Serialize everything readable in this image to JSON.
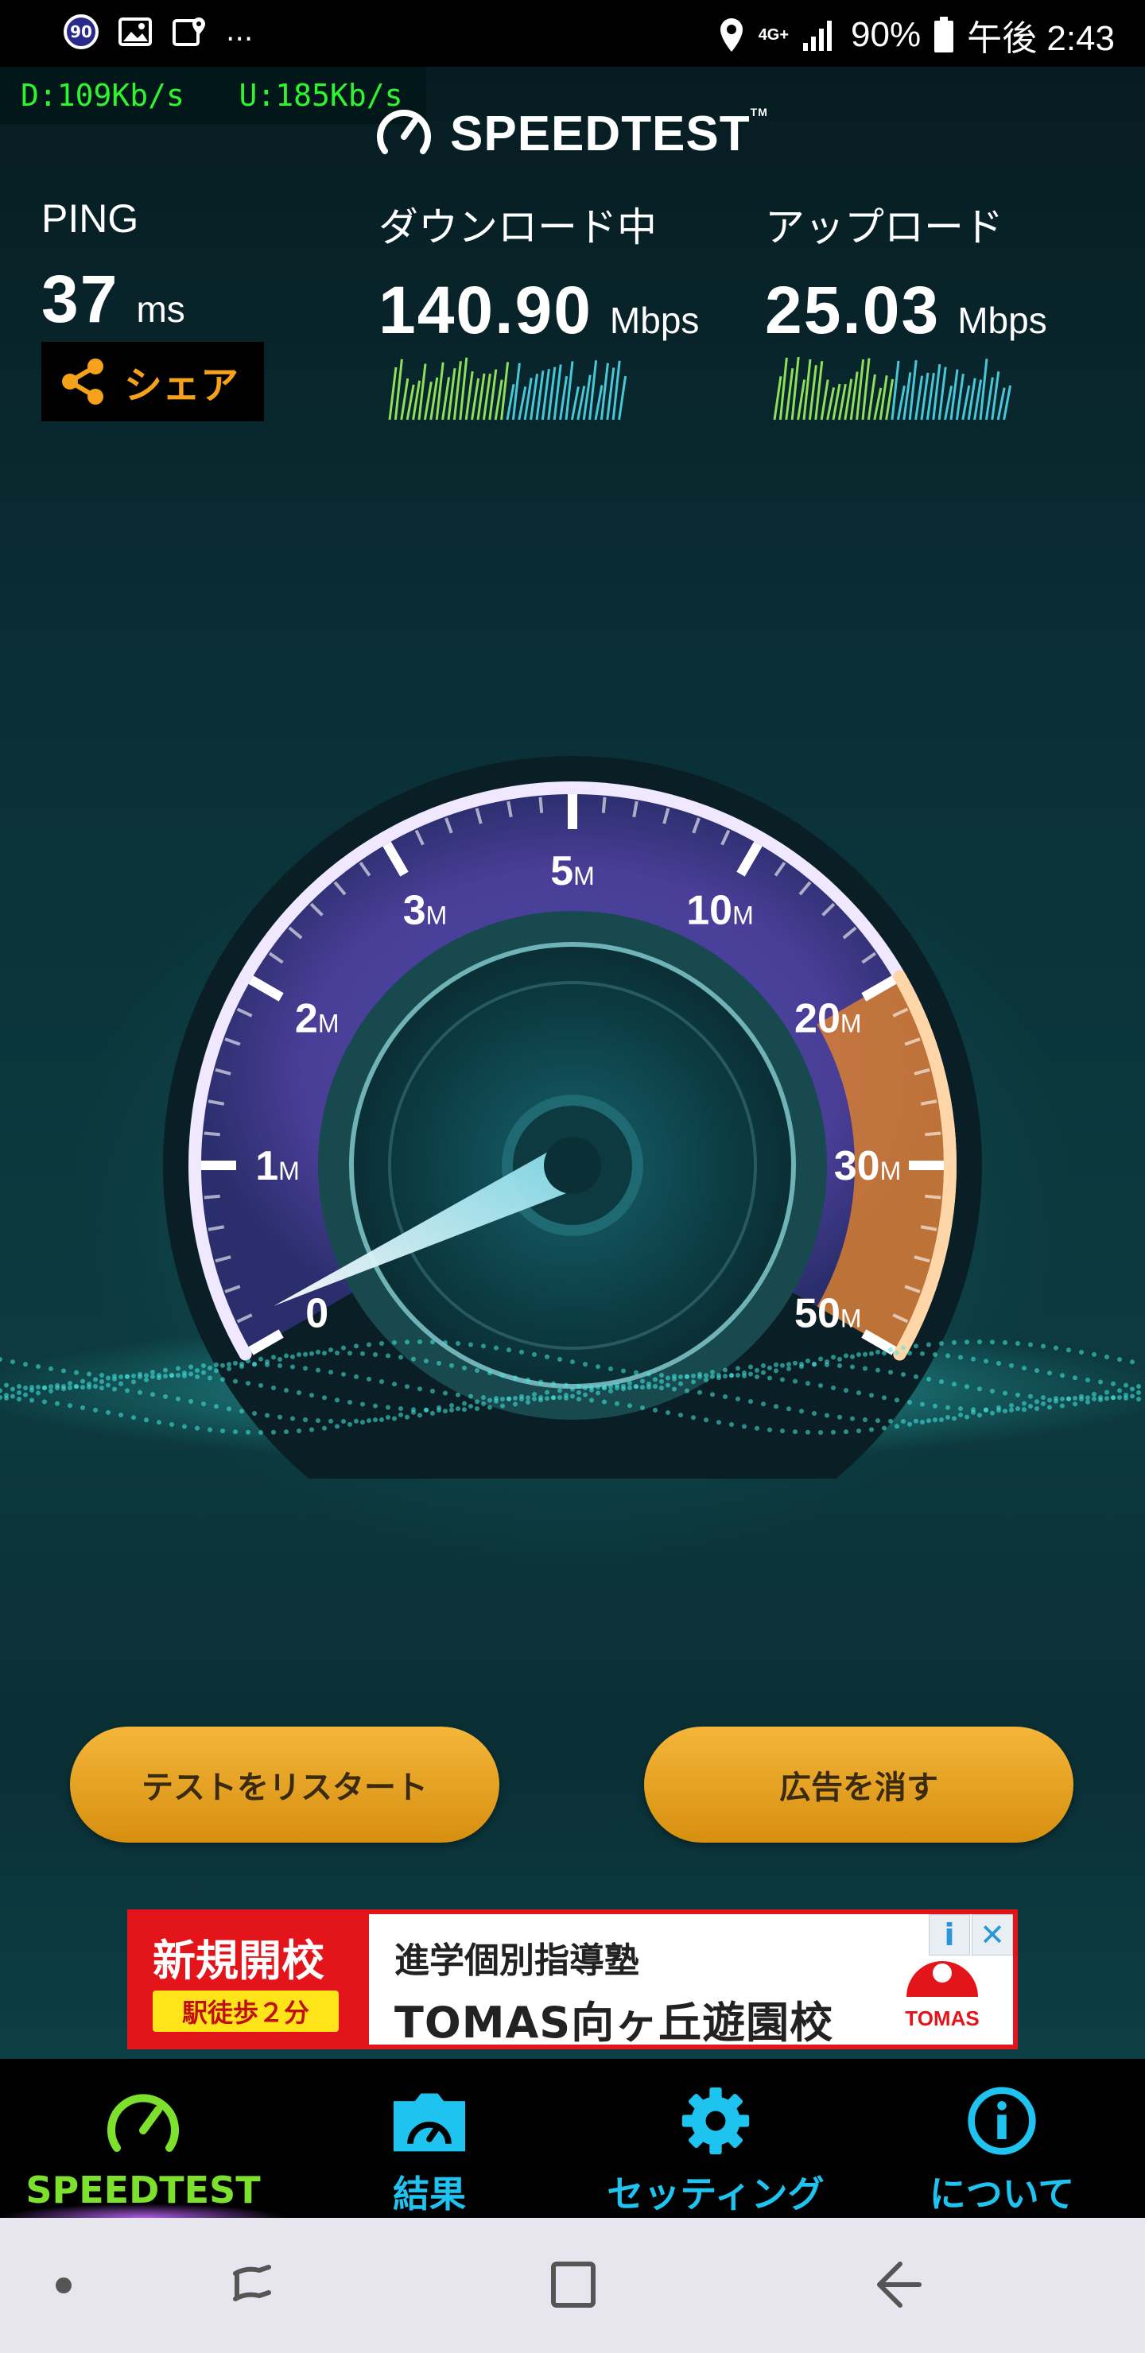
{
  "status_bar": {
    "badge": "90",
    "more": "...",
    "network": "4G+",
    "battery": "90%",
    "time": "午後 2:43"
  },
  "net_meter": {
    "download": "D:109Kb/s",
    "upload": "U:185Kb/s"
  },
  "header": {
    "logo": "SPEEDTEST",
    "trademark": "TM"
  },
  "ping": {
    "label": "PING",
    "value": "37",
    "unit": "ms"
  },
  "download": {
    "label": "ダウンロード中",
    "value": "140.90",
    "unit": "Mbps"
  },
  "upload": {
    "label": "アップロード",
    "value": "25.03",
    "unit": "Mbps"
  },
  "share": {
    "label": "シェア"
  },
  "gauge": {
    "ticks": [
      {
        "num": "0",
        "unit": ""
      },
      {
        "num": "1",
        "unit": "M"
      },
      {
        "num": "2",
        "unit": "M"
      },
      {
        "num": "3",
        "unit": "M"
      },
      {
        "num": "5",
        "unit": "M"
      },
      {
        "num": "10",
        "unit": "M"
      },
      {
        "num": "20",
        "unit": "M"
      },
      {
        "num": "30",
        "unit": "M"
      },
      {
        "num": "50",
        "unit": "M"
      }
    ],
    "needle_value_fraction": 0.02
  },
  "buttons": {
    "restart": "テストをリスタート",
    "remove_ads": "広告を消す"
  },
  "ad": {
    "headline": "新規開校",
    "sub": "駅徒歩２分",
    "line1": "進学個別指導塾",
    "line2": "TOMAS向ヶ丘遊園校",
    "brand": "TOMAS",
    "info": "i",
    "close": "✕"
  },
  "bottom_nav": [
    {
      "label": "SPEEDTEST",
      "icon": "speedometer-icon",
      "color": "#7de02c",
      "active": true
    },
    {
      "label": "結果",
      "icon": "results-folder-icon",
      "color": "#1ec3f0",
      "active": false
    },
    {
      "label": "セッティング",
      "icon": "gear-icon",
      "color": "#1ec3f0",
      "active": false
    },
    {
      "label": "について",
      "icon": "info-icon",
      "color": "#1ec3f0",
      "active": false
    }
  ],
  "colors": {
    "accent_orange": "#f5a21a",
    "gauge_purple": "#7a5cc8",
    "gauge_orange": "#e2832c",
    "nav_green": "#7de02c",
    "nav_cyan": "#1ec3f0",
    "ad_red": "#e3151b"
  }
}
